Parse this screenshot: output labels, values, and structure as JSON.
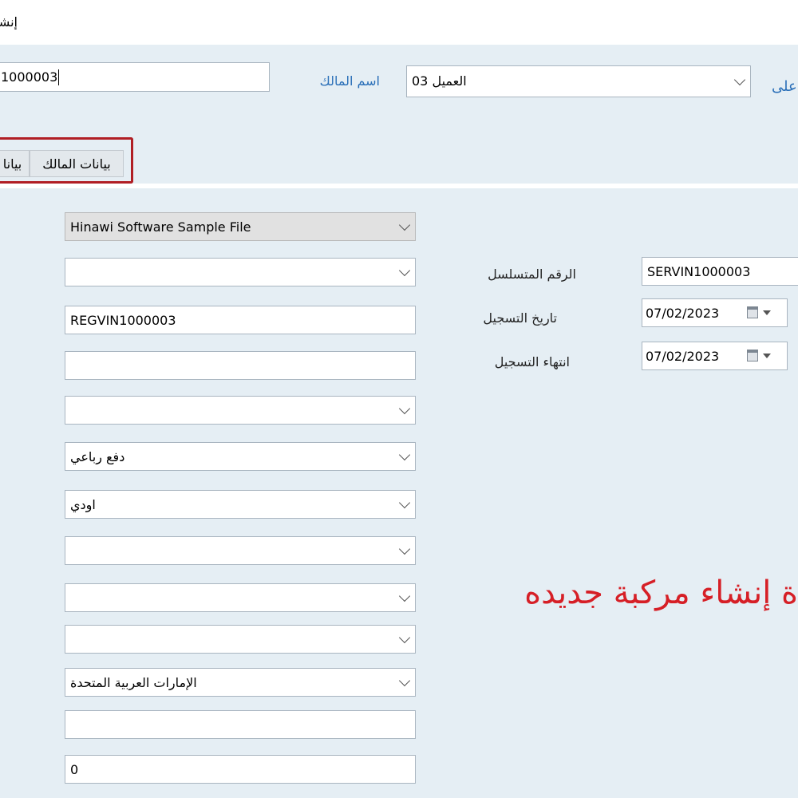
{
  "window": {
    "title": "إنشاء"
  },
  "header": {
    "owner_code_value": "1000003",
    "owner_name_label": "اسم المالك",
    "customer_select_value": "العميل 03",
    "partial_label": "على"
  },
  "tabs": [
    {
      "label": "بيانات المالك"
    },
    {
      "label": "بيانا"
    }
  ],
  "left_fields": [
    {
      "value": "Hinawi Software Sample File",
      "type": "select",
      "disabled": true
    },
    {
      "value": "",
      "type": "select"
    },
    {
      "value": "REGVIN1000003",
      "type": "text"
    },
    {
      "value": "",
      "type": "text"
    },
    {
      "value": "",
      "type": "select"
    },
    {
      "value": "دفع رباعي",
      "type": "select"
    },
    {
      "value": "اودي",
      "type": "select"
    },
    {
      "value": "",
      "type": "select"
    },
    {
      "value": "",
      "type": "select"
    },
    {
      "value": "",
      "type": "select"
    },
    {
      "value": "الإمارات العربية المتحدة",
      "type": "select"
    },
    {
      "value": "",
      "type": "text"
    },
    {
      "value": "0",
      "type": "text"
    }
  ],
  "right_fields": {
    "serial": {
      "label": "الرقم المتسلسل",
      "value": "SERVIN1000003"
    },
    "reg_date": {
      "label": "تاريخ التسجيل",
      "value": "07/02/2023"
    },
    "reg_expiry": {
      "label": "انتهاء التسجيل",
      "value": "07/02/2023"
    }
  },
  "overlay": {
    "caption": "ة إنشاء مركبة جديده"
  },
  "icons": [
    "chevron-down-icon",
    "calendar-icon",
    "dropdown-arrow-icon"
  ],
  "colors": {
    "accent_blue": "#2a6fb8",
    "highlight_red": "#b01e24",
    "caption_red": "#d61f26",
    "background": "#e5eef4"
  }
}
